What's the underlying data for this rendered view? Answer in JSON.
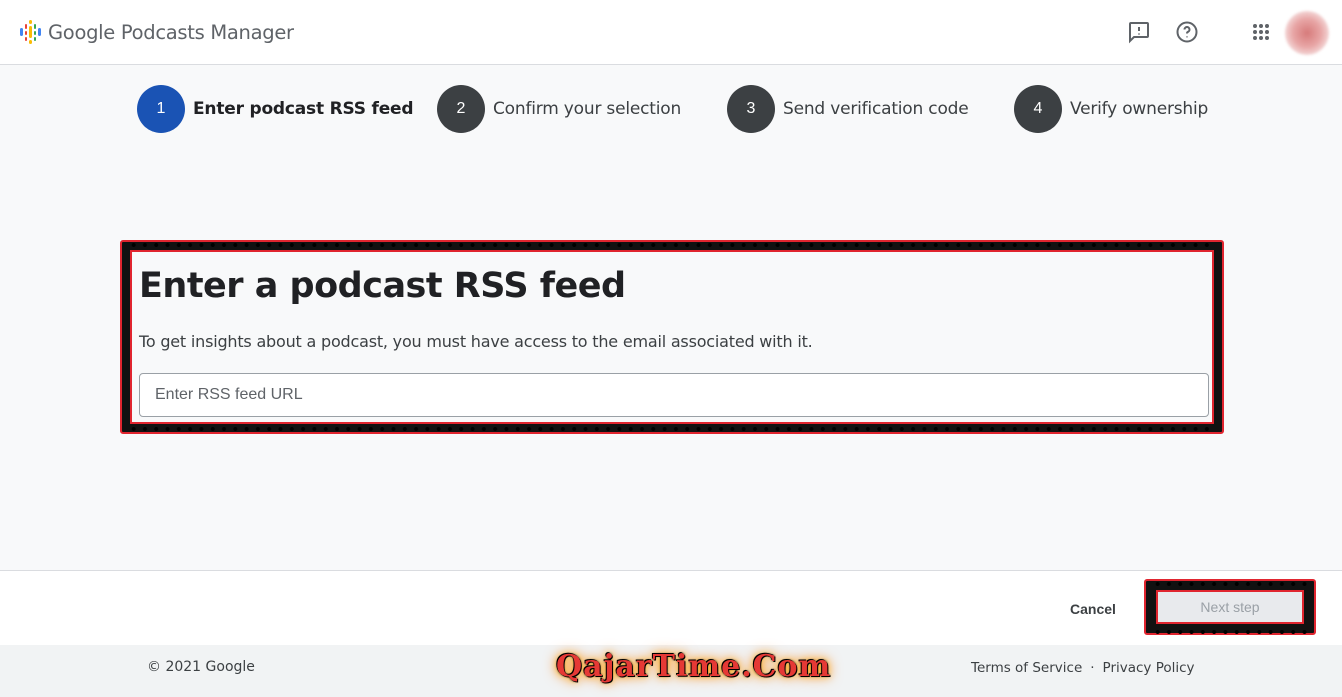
{
  "header": {
    "app_title": "Google Podcasts Manager",
    "icons": [
      "feedback-icon",
      "help-icon",
      "apps-grid-icon"
    ],
    "logo_colors": [
      "#fbbc04",
      "#ea4335",
      "#34a853",
      "#4285f4",
      "#fbbc04"
    ]
  },
  "stepper": {
    "steps": [
      {
        "number": "1",
        "label": "Enter podcast RSS feed",
        "active": true
      },
      {
        "number": "2",
        "label": "Confirm your selection",
        "active": false
      },
      {
        "number": "3",
        "label": "Send verification code",
        "active": false
      },
      {
        "number": "4",
        "label": "Verify ownership",
        "active": false
      }
    ],
    "active_color": "#1a53b4",
    "inactive_color": "#3c4043"
  },
  "main": {
    "title": "Enter a podcast RSS feed",
    "description": "To get insights about a podcast, you must have access to the email associated with it.",
    "rss_input": {
      "placeholder": "Enter RSS feed URL",
      "value": ""
    }
  },
  "actions": {
    "cancel_label": "Cancel",
    "next_label": "Next step"
  },
  "footer": {
    "copyright": "© 2021 Google",
    "terms": "Terms of Service",
    "separator": "·",
    "privacy": "Privacy Policy",
    "watermark": "QajarTime.Com"
  },
  "highlight_color": "#e0252f"
}
